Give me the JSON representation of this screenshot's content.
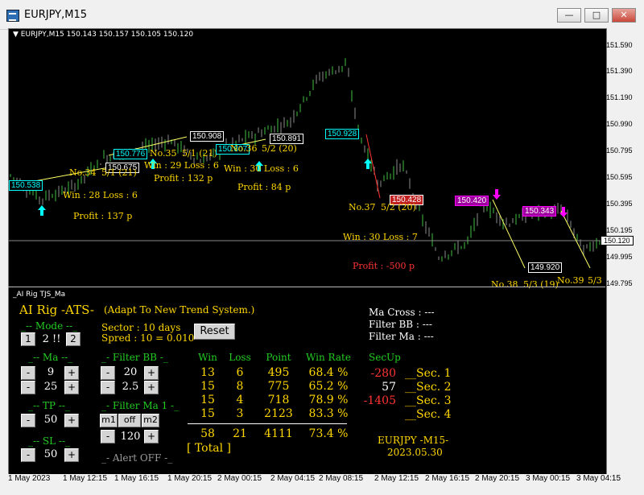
{
  "window": {
    "title": "EURJPY,M15"
  },
  "chart": {
    "symbol_info": "EURJPY,M15  150.143 150.157 150.105 150.120",
    "current_price": "150.120",
    "y_ticks": [
      "151.590",
      "151.390",
      "151.190",
      "150.990",
      "150.795",
      "150.595",
      "150.395",
      "150.195",
      "149.995",
      "149.795"
    ],
    "x_ticks": [
      "1 May 2023",
      "1 May 12:15",
      "1 May 16:15",
      "1 May 20:15",
      "2 May 00:15",
      "2 May 04:15",
      "2 May 08:15",
      "2 May 12:15",
      "2 May 16:15",
      "2 May 20:15",
      "3 May 00:15",
      "3 May 04:15"
    ],
    "trades": [
      {
        "entry": "150.538",
        "exit": "150.675",
        "no": "No.34",
        "date": "5/1 (21)",
        "winloss": "Win : 28   Loss : 6",
        "profit": "Profit : 137 p"
      },
      {
        "entry": "150.776",
        "exit": "150.908",
        "no": "No.35",
        "date": "5/1 (21)",
        "winloss": "Win : 29   Loss : 6",
        "profit": "Profit : 132 p"
      },
      {
        "entry": "150.807",
        "exit": "150.891",
        "no": "No.36",
        "date": "5/2 (20)",
        "winloss": "Win : 30   Loss : 6",
        "profit": "Profit : 84 p"
      },
      {
        "entry": "150.928",
        "exit": "150.428",
        "no": "No.37",
        "date": "5/2 (20)",
        "winloss": "Win : 30   Loss : 7",
        "profit": "Profit : -500 p"
      },
      {
        "entry": "150.420",
        "exit": "149.920",
        "no": "No.38",
        "date": "5/3 (19)"
      },
      {
        "entry": "150.343",
        "no": "No.39",
        "date": "5/3"
      }
    ]
  },
  "indicator": {
    "name": "_AI Rig TJS_Ma",
    "title": "AI Rig   -ATS-",
    "subtitle": "(Adapt To New Trend System.)",
    "sector": "Sector : 10 days",
    "spred": "Spred : 10 = 0.010",
    "reset": "Reset",
    "mode": {
      "label": "_-- Mode --_",
      "left": "1",
      "value": "2 !!",
      "right": "2"
    },
    "ma": {
      "label": "_-- Ma --_",
      "v1": "9",
      "v2": "25"
    },
    "tp": {
      "label": "_-- TP --_",
      "value": "50"
    },
    "sl": {
      "label": "_-- SL --_",
      "value": "50"
    },
    "filter_bb": {
      "label": "_- Filter BB -_",
      "v1": "20",
      "v2": "2.5"
    },
    "filter_ma": {
      "label": "_- Filter Ma 1 -_",
      "opts": [
        "m1",
        "off",
        "m2"
      ],
      "value": "120"
    },
    "alert": "_- Alert OFF -_",
    "minus": "-",
    "plus": "+",
    "stats": {
      "headers": [
        "Win",
        "Loss",
        "Point",
        "Win Rate"
      ],
      "rows": [
        [
          "13",
          "6",
          "495",
          "68.4 %"
        ],
        [
          "15",
          "8",
          "775",
          "65.2 %"
        ],
        [
          "15",
          "4",
          "718",
          "78.9 %"
        ],
        [
          "15",
          "3",
          "2123",
          "83.3 %"
        ]
      ],
      "total": [
        "58",
        "21",
        "4111",
        "73.4 %"
      ],
      "total_label": "[ Total ]"
    },
    "secup": {
      "label": "SecUp",
      "values": [
        "-280",
        "57",
        "-1405",
        ""
      ],
      "secs": [
        "__Sec. 1",
        "__Sec. 2",
        "__Sec. 3",
        "__Sec. 4"
      ]
    },
    "cross": [
      "Ma Cross : ---",
      "Filter BB   : ---",
      "Filter Ma  : ---"
    ],
    "footer_sym": "EURJPY  -M15-",
    "footer_date": "2023.05.30"
  },
  "colors": {
    "bull": "#33ff33",
    "ma_line": "#ffff66",
    "red": "#ff3333",
    "cyan": "#00ffff",
    "magenta": "#ff00ff",
    "yellow": "#ffd700",
    "green": "#22cc22"
  }
}
